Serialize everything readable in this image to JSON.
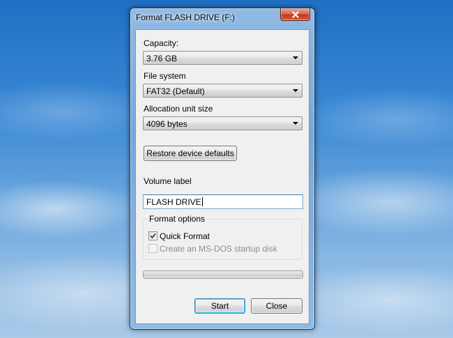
{
  "window": {
    "title": "Format FLASH DRIVE (F:)"
  },
  "capacity": {
    "label": "Capacity:",
    "value": "3.76 GB"
  },
  "file_system": {
    "label": "File system",
    "value": "FAT32 (Default)"
  },
  "allocation": {
    "label": "Allocation unit size",
    "value": "4096 bytes"
  },
  "restore_button": {
    "label": "Restore device defaults"
  },
  "volume": {
    "label": "Volume label",
    "value": "FLASH DRIVE"
  },
  "format_options": {
    "legend": "Format options",
    "quick_format": {
      "label": "Quick Format",
      "checked": true,
      "enabled": true
    },
    "msdos_startup": {
      "label": "Create an MS-DOS startup disk",
      "checked": false,
      "enabled": false
    }
  },
  "progress": {
    "fraction": 0
  },
  "buttons": {
    "start": "Start",
    "close": "Close"
  },
  "icons": {
    "close": "close-icon",
    "dropdown": "chevron-down-icon",
    "check": "checkmark-icon"
  },
  "colors": {
    "default_button_glow": "#48d2f8",
    "close_button": "#c23a1e",
    "progress_fill": "#06b025"
  }
}
